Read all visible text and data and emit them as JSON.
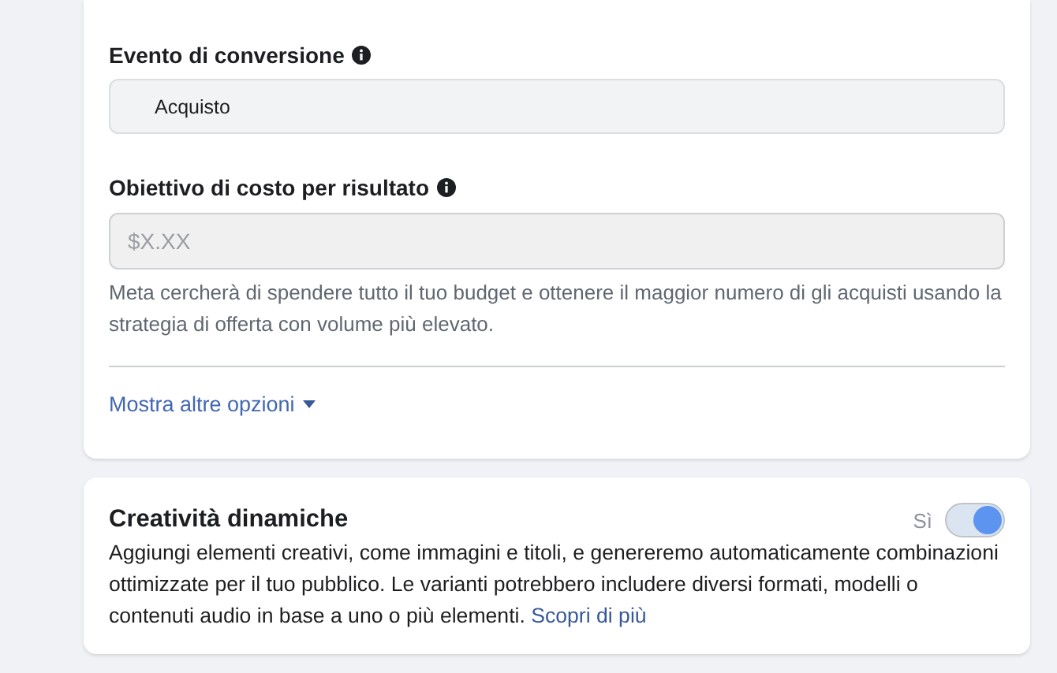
{
  "conversion_event": {
    "label": "Evento di conversione",
    "value": "Acquisto"
  },
  "cost_goal": {
    "label": "Obiettivo di costo per risultato",
    "placeholder": "$X.XX",
    "help": "Meta cercherà di spendere tutto il tuo budget e ottenere il maggior numero di gli acquisti usando la strategia di offerta con volume più elevato."
  },
  "more_options": {
    "label": "Mostra altre opzioni",
    "expanded": false
  },
  "dynamic_creative": {
    "title": "Creatività dinamiche",
    "toggle_label": "Sì",
    "on": true,
    "description": "Aggiungi elementi creativi, come immagini e titoli, e genereremo automaticamente combinazioni ottimizzate per il tuo pubblico. Le varianti potrebbero includere diversi formati, modelli o contenuti audio in base a uno o più elementi.",
    "link": "Scopri di più"
  }
}
